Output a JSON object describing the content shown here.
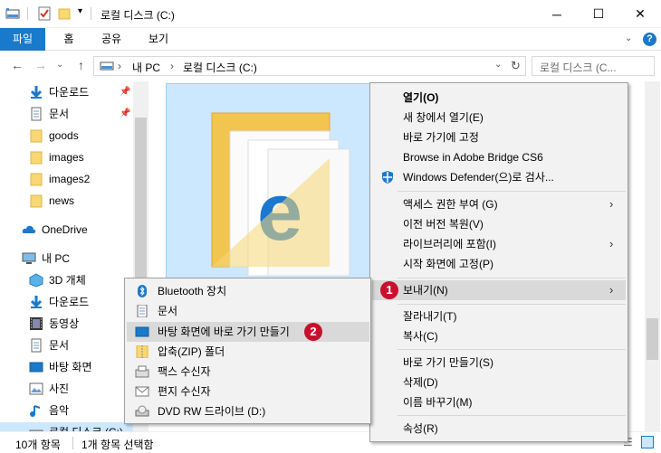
{
  "window": {
    "title": "로컬 디스크 (C:)",
    "controls": {
      "minimize": "─",
      "maximize": "☐",
      "close": "✕"
    }
  },
  "ribbon": {
    "tabs": [
      "파일",
      "홈",
      "공유",
      "보기"
    ],
    "help": "?"
  },
  "address": {
    "path_root": "내 PC",
    "path_sep": "›",
    "path_current": "로컬 디스크 (C:)",
    "search_placeholder": "로컬 디스크 (C..."
  },
  "sidebar": {
    "quick_access": [
      {
        "label": "다운로드",
        "icon": "download-icon",
        "pinned": true
      },
      {
        "label": "문서",
        "icon": "document-icon",
        "pinned": true
      },
      {
        "label": "goods",
        "icon": "folder-icon"
      },
      {
        "label": "images",
        "icon": "folder-icon"
      },
      {
        "label": "images2",
        "icon": "folder-icon"
      },
      {
        "label": "news",
        "icon": "folder-icon"
      }
    ],
    "onedrive": "OneDrive",
    "this_pc": "내 PC",
    "pc_items": [
      {
        "label": "3D 개체",
        "icon": "3d-objects-icon"
      },
      {
        "label": "다운로드",
        "icon": "download-icon"
      },
      {
        "label": "동영상",
        "icon": "video-icon"
      },
      {
        "label": "문서",
        "icon": "document-icon"
      },
      {
        "label": "바탕 화면",
        "icon": "desktop-icon"
      },
      {
        "label": "사진",
        "icon": "pictures-icon"
      },
      {
        "label": "음악",
        "icon": "music-icon"
      },
      {
        "label": "로컬 디스크 (C:)",
        "icon": "drive-icon"
      }
    ]
  },
  "status": {
    "item_count": "10개 항목",
    "selected": "1개 항목 선택함"
  },
  "context_menu": {
    "items": [
      {
        "label": "열기(O)",
        "bold": true
      },
      {
        "label": "새 창에서 열기(E)"
      },
      {
        "label": "바로 가기에 고정"
      },
      {
        "label": "Browse in Adobe Bridge CS6"
      },
      {
        "label": "Windows Defender(으)로 검사..."
      },
      {
        "label": "액세스 권한 부여 (G)",
        "submenu": true
      },
      {
        "label": "이전 버전 복원(V)"
      },
      {
        "label": "라이브러리에 포함(I)",
        "submenu": true
      },
      {
        "label": "시작 화면에 고정(P)"
      },
      {
        "label": "보내기(N)",
        "submenu": true,
        "highlighted": true
      },
      {
        "label": "잘라내기(T)"
      },
      {
        "label": "복사(C)"
      },
      {
        "label": "바로 가기 만들기(S)"
      },
      {
        "label": "삭제(D)"
      },
      {
        "label": "이름 바꾸기(M)"
      },
      {
        "label": "속성(R)"
      }
    ],
    "badge_1": "1",
    "badge_2": "2"
  },
  "send_to_menu": {
    "items": [
      {
        "label": "Bluetooth 장치",
        "icon": "bluetooth-icon"
      },
      {
        "label": "문서",
        "icon": "document-icon"
      },
      {
        "label": "바탕 화면에 바로 가기 만들기",
        "icon": "desktop-icon",
        "highlighted": true
      },
      {
        "label": "압축(ZIP) 폴더",
        "icon": "zip-folder-icon"
      },
      {
        "label": "팩스 수신자",
        "icon": "fax-icon"
      },
      {
        "label": "편지 수신자",
        "icon": "mail-icon"
      },
      {
        "label": "DVD RW 드라이브 (D:)",
        "icon": "dvd-drive-icon"
      }
    ]
  },
  "colors": {
    "accent": "#1979ca",
    "selection": "#cce8ff",
    "menu_bg": "#f2f2f2",
    "badge": "#c8102e"
  }
}
